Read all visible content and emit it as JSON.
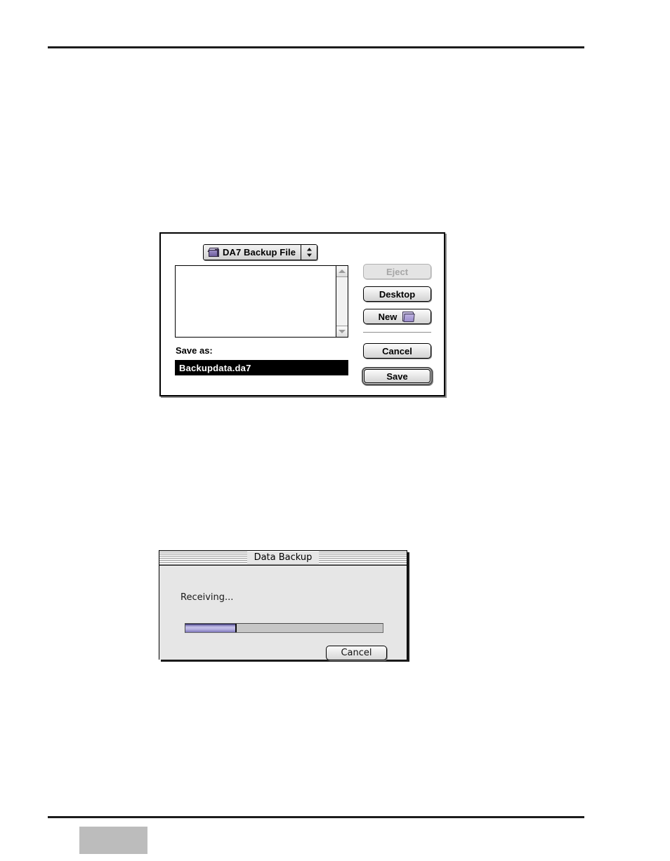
{
  "page": {
    "top_rule": true,
    "bottom_rule": true,
    "page_number_block": ""
  },
  "save_dialog": {
    "name": "Save As dialog",
    "folder_popup": {
      "label": "DA7 Backup File",
      "icon": "backup-volume-icon",
      "arrow_icon": "updown-arrows-icon"
    },
    "file_list": {
      "items": [],
      "scrollbar": {
        "up_arrow_icon": "scroll-up-arrow-icon",
        "down_arrow_icon": "scroll-down-arrow-icon"
      }
    },
    "save_as_label": "Save as:",
    "filename_value": "Backupdata.da7",
    "filename_selected": true,
    "buttons": {
      "eject": "Eject",
      "eject_enabled": false,
      "desktop": "Desktop",
      "new": "New",
      "new_icon": "new-folder-icon",
      "cancel": "Cancel",
      "save": "Save",
      "default_button": "Save"
    }
  },
  "progress_dialog": {
    "title": "Data Backup",
    "status": "Receiving...",
    "progress_percent": 26,
    "cancel_label": "Cancel"
  },
  "colors": {
    "accent_purple": "#8c86c4",
    "dialog_face": "#e6e6e6",
    "page_block_grey": "#bcbcbc"
  }
}
